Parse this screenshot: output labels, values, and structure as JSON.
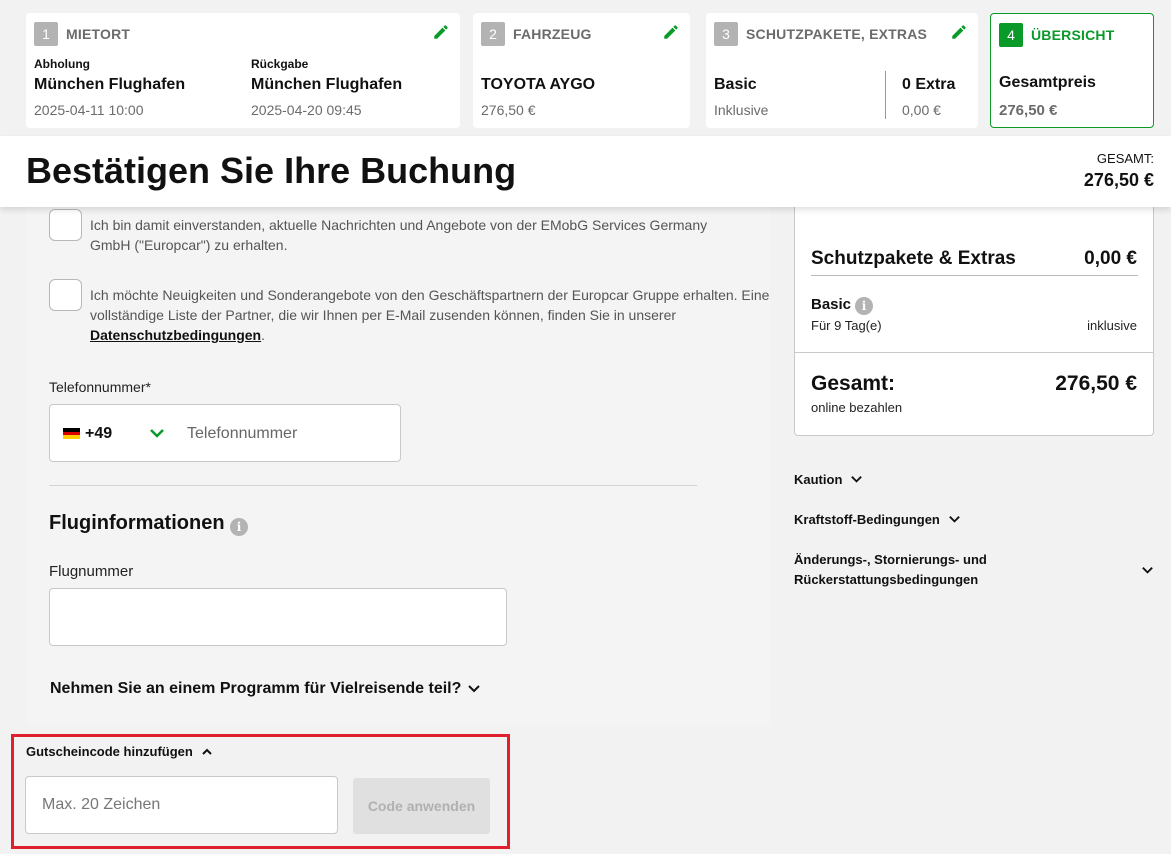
{
  "steps": {
    "mietort": {
      "num": "1",
      "title": "MIETORT",
      "pickup_label": "Abholung",
      "pickup_location": "München Flughafen",
      "pickup_time": "2025-04-11 10:00",
      "return_label": "Rückgabe",
      "return_location": "München Flughafen",
      "return_time": "2025-04-20 09:45"
    },
    "fahrzeug": {
      "num": "2",
      "title": "FAHRZEUG",
      "car": "TOYOTA AYGO",
      "price": "276,50 €"
    },
    "schutz": {
      "num": "3",
      "title": "SCHUTZPAKETE, EXTRAS",
      "package": "Basic",
      "package_sub": "Inklusive",
      "extras": "0 Extra",
      "extras_price": "0,00 €"
    },
    "uebersicht": {
      "num": "4",
      "title": "ÜBERSICHT",
      "label": "Gesamtpreis",
      "price": "276,50 €"
    }
  },
  "header": {
    "title": "Bestätigen Sie Ihre Buchung",
    "total_label": "GESAMT:",
    "total_value": "276,50 €"
  },
  "form": {
    "consent1": "Ich bin damit einverstanden, aktuelle Nachrichten und Angebote von der EMobG Services Germany GmbH (\"Europcar\") zu erhalten.",
    "consent2_text": "Ich möchte Neuigkeiten und Sonderangebote von den Geschäftspartnern der Europcar Gruppe erhalten. Eine vollständige Liste der Partner, die wir Ihnen per E-Mail zusenden können, finden Sie in unserer",
    "consent2_link": "Datenschutzbedingungen",
    "phone_label": "Telefonnummer*",
    "phone_code": "+49",
    "phone_placeholder": "Telefonnummer",
    "flight_section": "Fluginformationen",
    "flight_label": "Flugnummer",
    "frequent_flyer": "Nehmen Sie an einem Programm für Vielreisende teil?"
  },
  "voucher": {
    "title": "Gutscheincode hinzufügen",
    "placeholder": "Max. 20 Zeichen",
    "button": "Code anwenden"
  },
  "summary": {
    "extras_title": "Schutzpakete & Extras",
    "extras_value": "0,00 €",
    "basic": "Basic",
    "days": "Für 9 Tag(e)",
    "included": "inklusive",
    "total_title": "Gesamt:",
    "total_sub": "online bezahlen",
    "total_value": "276,50 €"
  },
  "accordions": {
    "kaution": "Kaution",
    "kraftstoff": "Kraftstoff-Bedingungen",
    "aenderung_line1": "Änderungs-, Stornierungs- und",
    "aenderung_line2": "Rückerstattungsbedingungen"
  },
  "colors": {
    "accent_green": "#0a9a2a",
    "highlight_red": "#e0202c"
  }
}
